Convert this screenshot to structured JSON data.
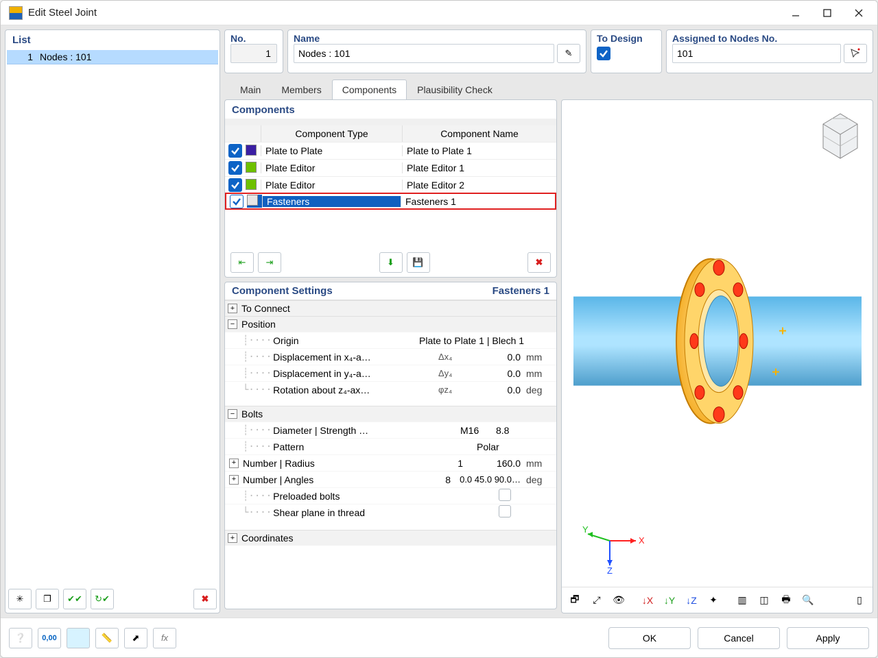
{
  "window": {
    "title": "Edit Steel Joint"
  },
  "list": {
    "header": "List",
    "items": [
      {
        "index": "1",
        "label": "Nodes : 101"
      }
    ]
  },
  "header": {
    "no_label": "No.",
    "no_value": "1",
    "name_label": "Name",
    "name_value": "Nodes : 101",
    "todesign_label": "To Design",
    "assigned_label": "Assigned to Nodes No.",
    "assigned_value": "101"
  },
  "tabs": {
    "main": "Main",
    "members": "Members",
    "components": "Components",
    "plausibility": "Plausibility Check",
    "active": "components"
  },
  "components_panel": {
    "title": "Components",
    "th_type": "Component Type",
    "th_name": "Component Name",
    "rows": [
      {
        "color": "#3b1fa3",
        "type": "Plate to Plate",
        "name": "Plate to Plate 1"
      },
      {
        "color": "#6ec000",
        "type": "Plate Editor",
        "name": "Plate Editor 1"
      },
      {
        "color": "#6ec000",
        "type": "Plate Editor",
        "name": "Plate Editor 2"
      },
      {
        "color": "#e6e6e6",
        "type": "Fasteners",
        "name": "Fasteners 1"
      }
    ],
    "selected_index": 3
  },
  "settings": {
    "title": "Component Settings",
    "name": "Fasteners 1",
    "groups": {
      "to_connect": "To Connect",
      "position": "Position",
      "bolts": "Bolts",
      "coordinates": "Coordinates"
    },
    "position": {
      "origin_label": "Origin",
      "origin_value": "Plate to Plate 1 | Blech 1",
      "dx_label": "Displacement in x₄-a…",
      "dx_sym": "Δx₄",
      "dx_val": "0.0",
      "dx_unit": "mm",
      "dy_label": "Displacement in y₄-a…",
      "dy_sym": "Δy₄",
      "dy_val": "0.0",
      "dy_unit": "mm",
      "rz_label": "Rotation about z₄-ax…",
      "rz_sym": "φz₄",
      "rz_val": "0.0",
      "rz_unit": "deg"
    },
    "bolts": {
      "diam_label": "Diameter | Strength …",
      "diam_v1": "M16",
      "diam_v2": "8.8",
      "pattern_label": "Pattern",
      "pattern_value": "Polar",
      "numrad_label": "Number | Radius",
      "numrad_n": "1",
      "numrad_r": "160.0",
      "numrad_unit": "mm",
      "numang_label": "Number | Angles",
      "numang_n": "8",
      "numang_a": "0.0 45.0 90.0…",
      "numang_unit": "deg",
      "preload_label": "Preloaded bolts",
      "shear_label": "Shear plane in thread"
    }
  },
  "footer": {
    "ok": "OK",
    "cancel": "Cancel",
    "apply": "Apply"
  },
  "axis": {
    "x": "X",
    "y": "Y",
    "z": "Z"
  }
}
